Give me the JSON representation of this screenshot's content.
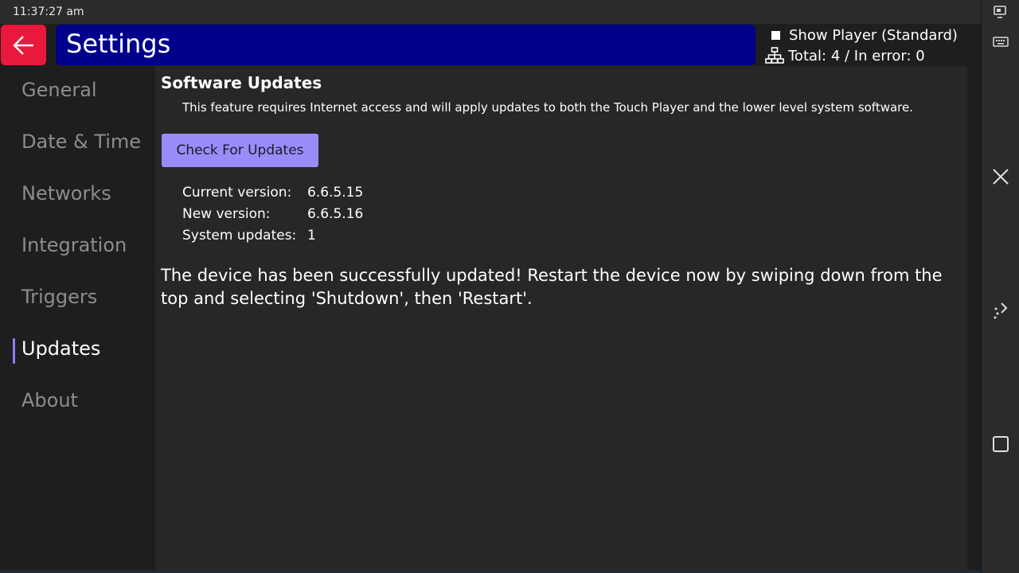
{
  "status_bar": {
    "time": "11:37:27 am"
  },
  "header": {
    "title": "Settings",
    "show_player_label": "Show Player (Standard)",
    "show_player_checked": false,
    "totals_label": "Total: 4 / In error: 0"
  },
  "sidebar": {
    "items": [
      {
        "label": "General",
        "active": false
      },
      {
        "label": "Date & Time",
        "active": false
      },
      {
        "label": "Networks",
        "active": false
      },
      {
        "label": "Integration",
        "active": false
      },
      {
        "label": "Triggers",
        "active": false
      },
      {
        "label": "Updates",
        "active": true
      },
      {
        "label": "About",
        "active": false
      }
    ]
  },
  "main": {
    "section_title": "Software Updates",
    "description": "This feature requires Internet access and will apply updates to both the Touch Player and the lower level system software.",
    "check_button_label": "Check For Updates",
    "info": [
      {
        "label": "Current version:",
        "value": "6.6.5.15"
      },
      {
        "label": "New version:",
        "value": "6.6.5.16"
      },
      {
        "label": "System updates:",
        "value": "1"
      }
    ],
    "result_message": "The device has been successfully updated! Restart the device now by swiping down from the top and selecting 'Shutdown', then 'Restart'."
  },
  "nav_rail": {
    "icons": [
      "screen-cast-icon",
      "keyboard-icon",
      "close-icon",
      "rotate-icon",
      "square-icon"
    ]
  },
  "colors": {
    "back_button": "#e8193c",
    "title_bar": "#00008b",
    "accent": "#9a8cf8",
    "background": "#1e1e1e",
    "panel": "#272727"
  }
}
